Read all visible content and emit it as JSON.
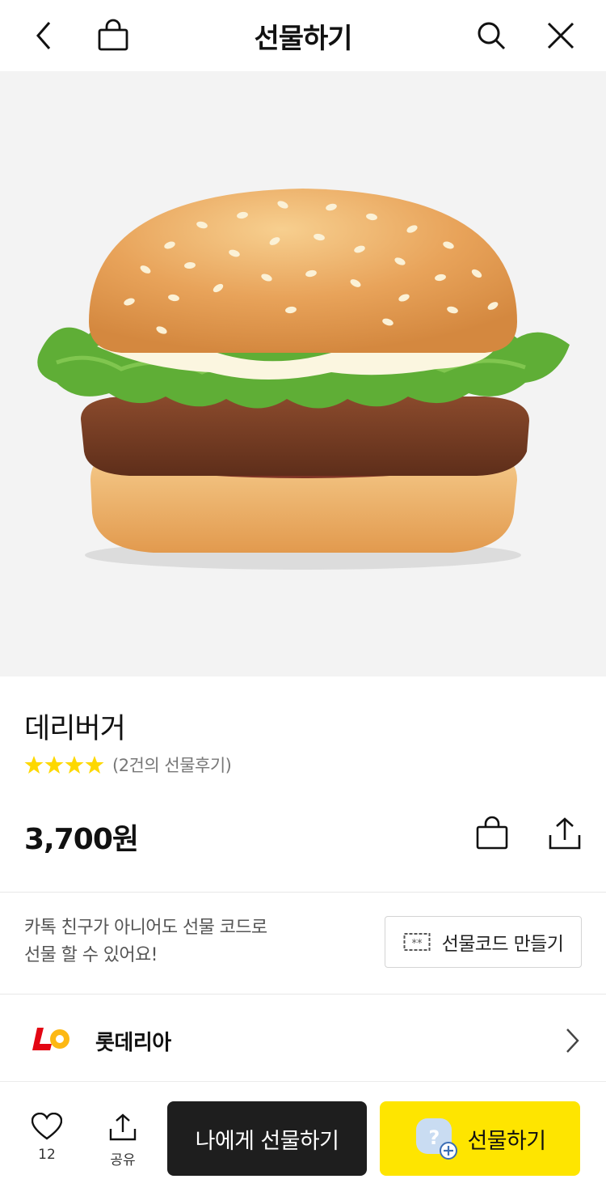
{
  "header": {
    "title": "선물하기",
    "back_icon": "back-arrow-icon",
    "bag_icon": "shopping-bag-icon",
    "search_icon": "search-icon",
    "close_icon": "close-icon"
  },
  "product": {
    "image": "burger-image",
    "name": "데리버거",
    "rating_stars": 4,
    "review_text": "(2건의 선물후기)",
    "price": "3,700원"
  },
  "gift_code": {
    "line1": "카톡 친구가 아니어도 선물 코드로",
    "line2": "선물 할 수 있어요!",
    "button_label": "선물코드 만들기"
  },
  "brand": {
    "name": "롯데리아"
  },
  "bottom_bar": {
    "like_count": "12",
    "share_label": "공유",
    "self_gift_label": "나에게 선물하기",
    "gift_label": "선물하기"
  },
  "colors": {
    "accent_yellow": "#fee500",
    "dark_button": "#1e1e1e",
    "star": "#fdd800",
    "brand_red": "#e30613"
  }
}
